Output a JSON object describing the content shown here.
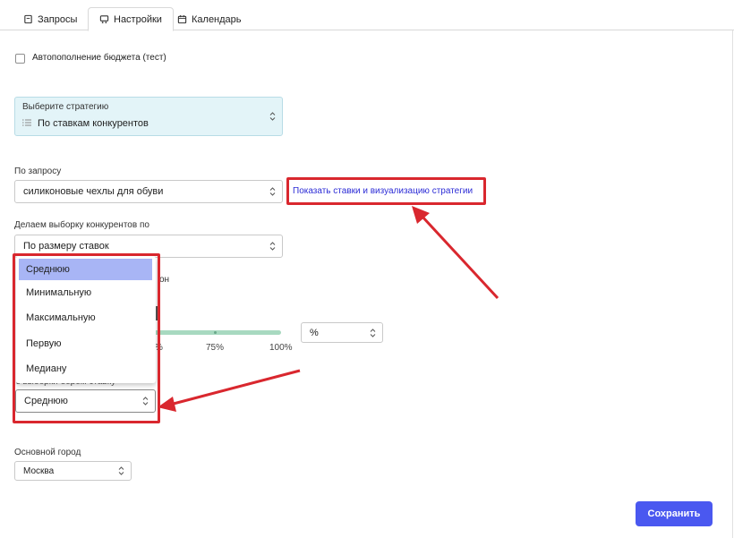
{
  "tabs": [
    {
      "label": "Запросы",
      "icon": "tag-icon"
    },
    {
      "label": "Настройки",
      "icon": "settings-icon"
    },
    {
      "label": "Календарь",
      "icon": "calendar-icon"
    }
  ],
  "active_tab": "Настройки",
  "autofill": {
    "label": "Автопополнение бюджета (тест)",
    "checked": false
  },
  "strategy": {
    "label": "Выберите стратегию",
    "value": "По ставкам конкурентов",
    "icon": "list-icon"
  },
  "query": {
    "label": "По запросу",
    "value": "силиконовые чехлы для обуви",
    "link": "Показать ставки и визуализацию стратегии"
  },
  "sampling": {
    "label": "Делаем выборку конкурентов по",
    "value": "По размеру ставок"
  },
  "range": {
    "label_partial": "он",
    "unit_value": "%",
    "ticks": [
      "%",
      "75%",
      "100%"
    ]
  },
  "dropdown": {
    "options": [
      "Среднюю",
      "Минимальную",
      "Максимальную",
      "Первую",
      "Медиану"
    ],
    "selected": "Среднюю"
  },
  "bid_choice": {
    "label_partial": "з выборки берем ставку",
    "value": "Среднюю"
  },
  "city": {
    "label": "Основной город",
    "value": "Москва"
  },
  "save_label": "Сохранить",
  "colors": {
    "accent": "#4a58f0",
    "annotation_red": "#d9272e",
    "link": "#2c2cd6",
    "strategy_bg": "#e3f4f8",
    "selected_option": "#a8b5f5"
  }
}
